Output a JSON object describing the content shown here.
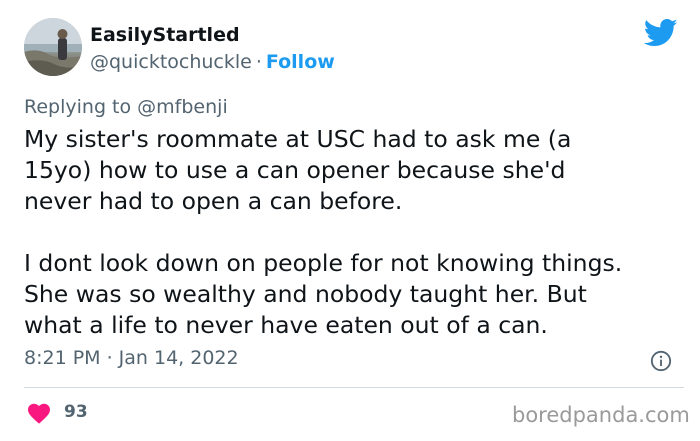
{
  "author": {
    "display_name": "EasilyStartled",
    "handle": "@quicktochuckle",
    "separator": "·",
    "follow_label": "Follow"
  },
  "reply_context": {
    "prefix": "Replying to",
    "handle": "@mfbenji"
  },
  "tweet": {
    "lines_paragraph_1": [
      "My sister's roommate at USC had to ask me (a",
      "15yo) how to use a can opener because she'd",
      "never had to open a can before."
    ],
    "lines_paragraph_2": [
      "I dont look down on people for not knowing things.",
      "She was so wealthy and nobody taught her. But",
      "what a life to never have eaten out of a can."
    ],
    "timestamp": "8:21 PM · Jan 14, 2022"
  },
  "engagement": {
    "like_count": "93"
  },
  "watermark": "boredpanda.com",
  "icons": {
    "brand": "twitter-bird-icon",
    "info": "info-icon",
    "like": "heart-icon"
  },
  "colors": {
    "accent": "#1d9bf0",
    "text": "#0f1419",
    "secondary": "#536471",
    "like": "#f91880",
    "divider": "#cfd9de",
    "watermark": "#9a9a9a"
  }
}
